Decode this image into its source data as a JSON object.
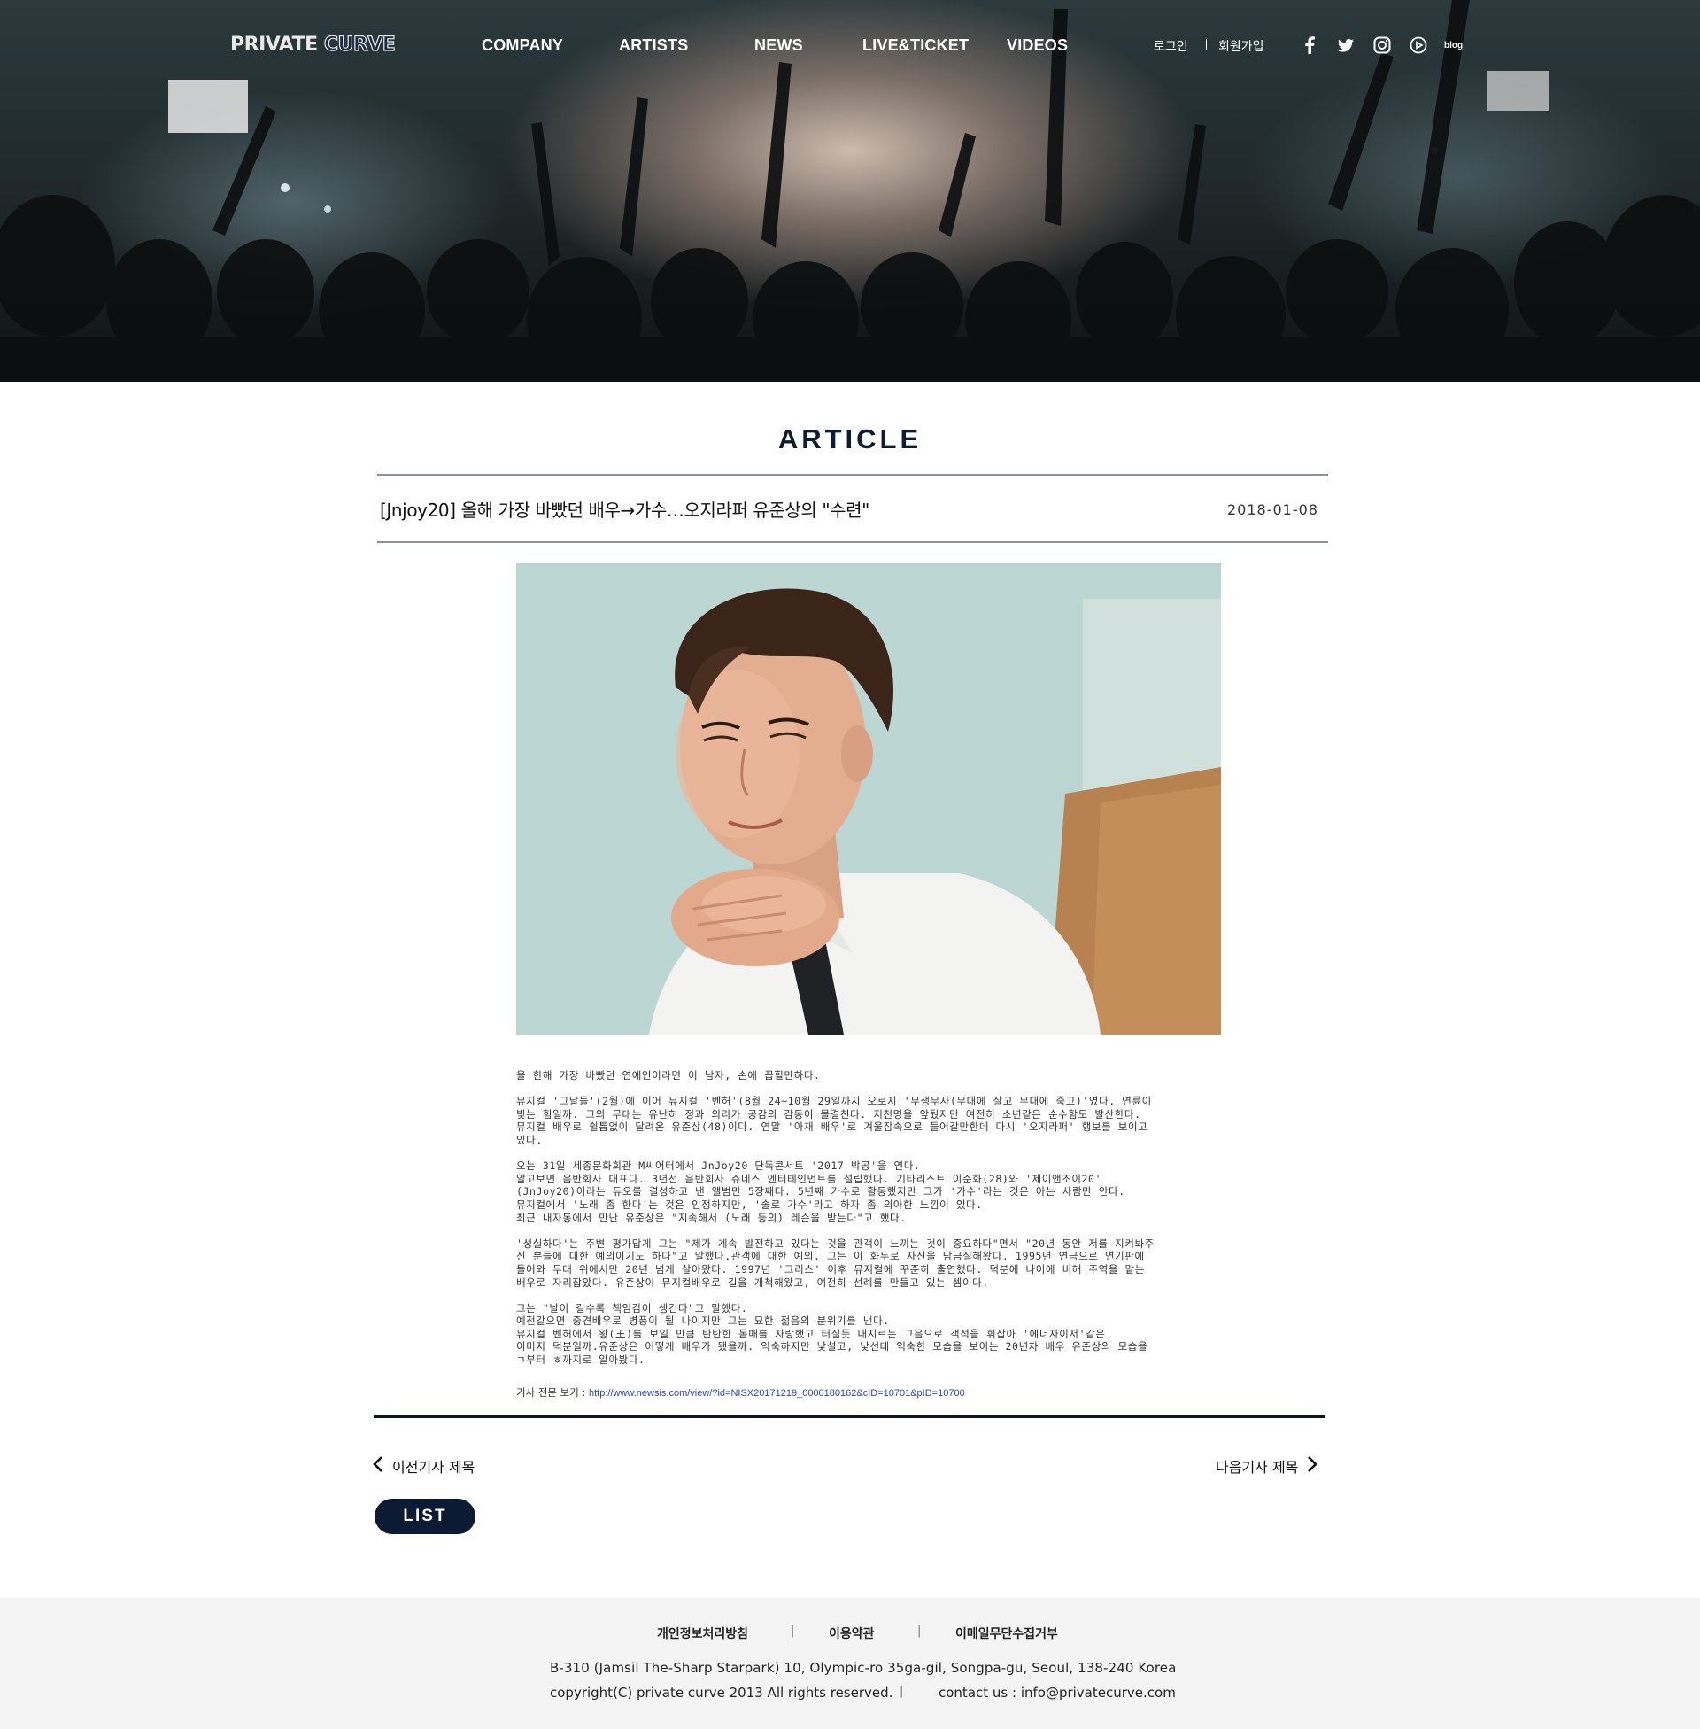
{
  "brand": {
    "logo_left": "PRIVATE",
    "logo_right": "CURVE"
  },
  "nav": {
    "items": [
      {
        "label": "COMPANY"
      },
      {
        "label": "ARTISTS"
      },
      {
        "label": "NEWS"
      },
      {
        "label": "LIVE&TICKET"
      },
      {
        "label": "VIDEOS"
      }
    ],
    "login": "로그인",
    "signup": "회원가입",
    "sns": [
      "facebook-icon",
      "twitter-icon",
      "instagram-icon",
      "youtube-icon",
      "blog-icon"
    ],
    "blog_label": "blog"
  },
  "article": {
    "section_title": "ARTICLE",
    "title": "[Jnjoy20] 올해 가장 바빴던 배우→가수…오지라퍼 유준상의 \"수련\"",
    "date": "2018-01-08",
    "paragraphs": [
      "올 한해 가장 바빴던 연예인이라면 이 남자, 손에 꼽힐만하다.",
      "뮤지컬 '그날들'(2월)에 이어 뮤지컬 '벤허'(8월 24~10월 29일까지 오로지 '무생무사(무대에 살고 무대에 죽고)'였다. 연륜이\n빛는 힘일까. 그의 무대는 유난히 정과 의리가 공감의 감동이 몰결친다. 지천명을 앞뒀지만 여전히 소년같은 순수함도 발산한다.\n뮤지컬 배우로 쉴틈없이 달려온 유준상(48)이다. 연말 '아재 배우'로 겨울잠속으로 들어갈만한데 다시 '오지라퍼' 행보를 보이고\n있다.",
      "오는 31일 세종문화회관 M씨어터에서 JnJoy20 단독콘서트 '2017 박공'을 연다.\n알고보면 음반회사 대표다. 3년전 음반회사 쥬네스 엔터테인먼트를 설립했다. 기타리스트 이준화(28)와 '제이앤조이20'\n(JnJoy20)이라는 듀오를 결성하고 낸 앨범만 5장째다. 5년째 가수로 활동했지만 그가 '가수'라는 것은 아는 사람만 안다.\n뮤지컬에서 '노래 좀 한다'는 것은 인정하지만, '솔로 가수'라고 하자 좀 의아한 느낌이 있다.\n최근 내자동에서 만난 유준상은 \"지속해서 (노래 등의) 레슨을 받는다\"고 했다.",
      "'성실하다'는 주변 평가답게 그는 \"제가 계속 발전하고 있다는 것을 관객이 느끼는 것이 중요하다\"면서 \"20년 동안 저를 지켜봐주\n신 분들에 대한 예의이기도 하다\"고 말했다.관객에 대한 예의. 그는 이 화두로 자신을 담금질해왔다. 1995년 연극으로 연기판에\n들어와 무대 위에서만 20년 넘게 살아왔다. 1997년 '그리스' 이후 뮤지컬에 꾸준히 출연했다. 덕분에 나이에 비해 주역을 맡는\n배우로 자리잡았다. 유준상이 뮤지컬배우로 길을 개척해왔고, 여전히 선례를 만들고 있는 셈이다.",
      "그는 \"날이 갈수록 책임감이 생긴다\"고 말했다.\n예전같으면 중견배우로 병풍이 될 나이지만 그는 묘한 젊음의 분위기를 낸다.\n뮤지컬 벤허에서 왕(王)를 보일 만큼 탄탄한 몸매를 자랑했고 터질듯 내지르는 고음으로 객석을 휘잡아 '에너자이저'같은\n이미지 덕분일까.유준상은 어떻게 배우가 됐을까. 익숙하지만 낯설고, 낯선데 익숙한 모습을 보이는 20년차 배우 유준상의 모습을\nㄱ부터 ㅎ까지로 알아봤다."
    ],
    "source_label": "기사 전문 보기 : ",
    "source_url": "http://www.newsis.com/view/?id=NISX20171219_0000180162&cID=10701&pID=10700",
    "prev_label": "이전기사 제목",
    "next_label": "다음기사 제목",
    "list_label": "LIST"
  },
  "footer": {
    "links": [
      "개인정보처리방침",
      "이용약관",
      "이메일무단수집거부"
    ],
    "address": "B-310 (Jamsil The-Sharp Starpark) 10, Olympic-ro 35ga-gil, Songpa-gu, Seoul, 138-240 Korea",
    "copyright": "copyright(C) private curve 2013 All rights reserved.",
    "contact": "contact us : info@privatecurve.com"
  },
  "colors": {
    "navy": "#0c1a33",
    "link_blue": "#2b3fd1",
    "footer_bg": "#f4f4f4"
  }
}
